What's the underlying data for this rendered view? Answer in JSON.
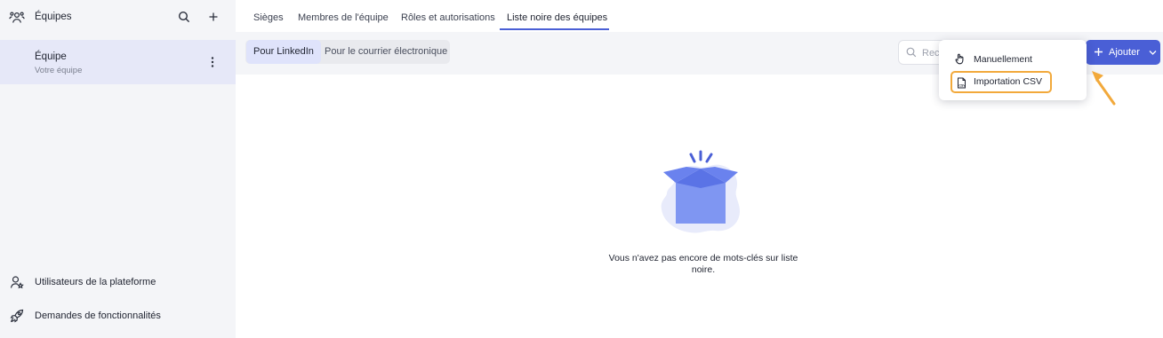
{
  "sidebar": {
    "header_title": "Équipes",
    "team": {
      "name": "Équipe",
      "subtitle": "Votre équipe"
    },
    "footer": [
      {
        "label": "Utilisateurs de la plateforme",
        "icon": "user-star-icon"
      },
      {
        "label": "Demandes de fonctionnalités",
        "icon": "rocket-icon"
      }
    ]
  },
  "tabs": [
    {
      "label": "Sièges",
      "active": false
    },
    {
      "label": "Membres de l'équipe",
      "active": false
    },
    {
      "label": "Rôles et autorisations",
      "active": false
    },
    {
      "label": "Liste noire des équipes",
      "active": true
    }
  ],
  "toolbar": {
    "segments": [
      {
        "label": "Pour LinkedIn",
        "active": true
      },
      {
        "label": "Pour le courrier électronique",
        "active": false
      }
    ],
    "search_placeholder": "Rech",
    "add_label": "Ajouter"
  },
  "menu": {
    "items": [
      {
        "label": "Manuellement",
        "icon": "hand-pointer-icon"
      },
      {
        "label": "Importation CSV",
        "icon": "csv-file-icon",
        "highlighted": true
      }
    ]
  },
  "empty_state": {
    "message": "Vous n'avez pas encore de mots-clés sur liste noire."
  },
  "colors": {
    "accent": "#4a5fd6",
    "highlight": "#f2a93b",
    "sidebar_bg": "#f4f5f8",
    "selected_bg": "#e6e8f8"
  }
}
